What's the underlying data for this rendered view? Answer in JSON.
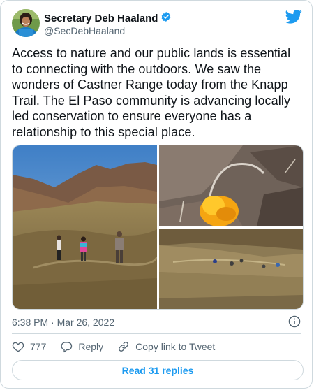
{
  "author": {
    "name": "Secretary Deb Haaland",
    "handle": "@SecDebHaaland",
    "verified_icon": "verified-badge-icon",
    "avatar_icon": "avatar-photo"
  },
  "brand": {
    "logo_icon": "twitter-bird-icon",
    "accent": "#1d9bf0"
  },
  "tweet": {
    "text": "Access to nature and our public lands is essential to connecting with the outdoors. We saw the wonders of Castner Range today from the Knapp Trail. The El Paso community is advancing locally led conservation to ensure everyone has a relationship to this special place.",
    "timestamp": "6:38 PM · Mar 26, 2022"
  },
  "media": {
    "photos": [
      "mountain-trail-hikers-photo",
      "yellow-poppy-photo",
      "hillside-hikers-photo"
    ]
  },
  "actions": {
    "like_count": "777",
    "reply_label": "Reply",
    "copy_link_label": "Copy link to Tweet"
  },
  "footer": {
    "read_replies_label": "Read 31 replies"
  },
  "icons": {
    "info": "info-icon",
    "heart": "heart-icon",
    "reply": "reply-icon",
    "link": "link-icon"
  }
}
